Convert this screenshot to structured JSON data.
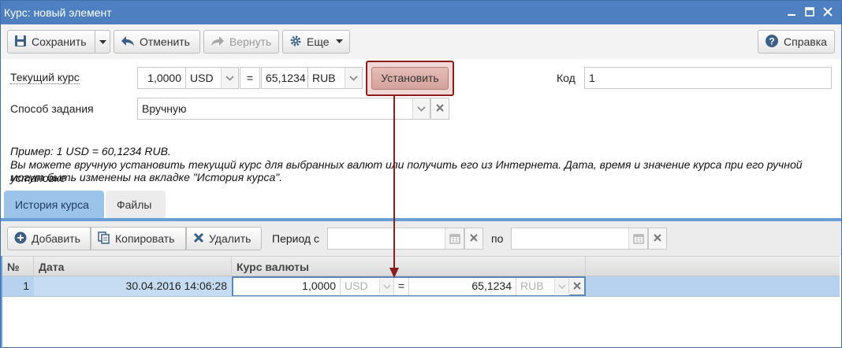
{
  "window": {
    "title": "Курс: новый элемент",
    "controls": [
      "minimize",
      "maximize",
      "close"
    ]
  },
  "toolbar": {
    "save_label": "Сохранить",
    "undo_label": "Отменить",
    "redo_label": "Вернуть",
    "more_label": "Еще",
    "help_label": "Справка"
  },
  "form": {
    "current_rate_label": "Текущий курс",
    "from_amount": "1,0000",
    "from_currency": "USD",
    "equals": "=",
    "to_amount": "65,1234",
    "to_currency": "RUB",
    "set_button_label": "Установить",
    "code_label": "Код",
    "code_value": "1",
    "method_label": "Способ задания",
    "method_value": "Вручную"
  },
  "hint": {
    "line1": "Пример: 1 USD = 60,1234 RUB.",
    "line2": "Вы можете вручную установить текущий курс для выбранных валют или получить его из Интернета. Дата, время и значение курса при его ручной установке",
    "line3": "могут быть изменены на вкладке \"История курса\"."
  },
  "tabs": [
    {
      "label": "История курса",
      "active": true
    },
    {
      "label": "Файлы",
      "active": false
    }
  ],
  "grid_toolbar": {
    "add_label": "Добавить",
    "copy_label": "Копировать",
    "delete_label": "Удалить",
    "period_from_label": "Период с",
    "period_to_label": "по"
  },
  "grid": {
    "columns": [
      "№",
      "Дата",
      "Курс валюты"
    ],
    "rows": [
      {
        "num": "1",
        "date": "30.04.2016 14:06:28",
        "from_amount": "1,0000",
        "from_currency": "USD",
        "equals": "=",
        "to_amount": "65,1234",
        "to_currency": "RUB"
      }
    ]
  },
  "colors": {
    "titlebar": "#4d7fc1",
    "active_tab": "#9cc3ea",
    "selected_row": "#b7d2ee",
    "highlight_border": "#8b1d1d"
  }
}
